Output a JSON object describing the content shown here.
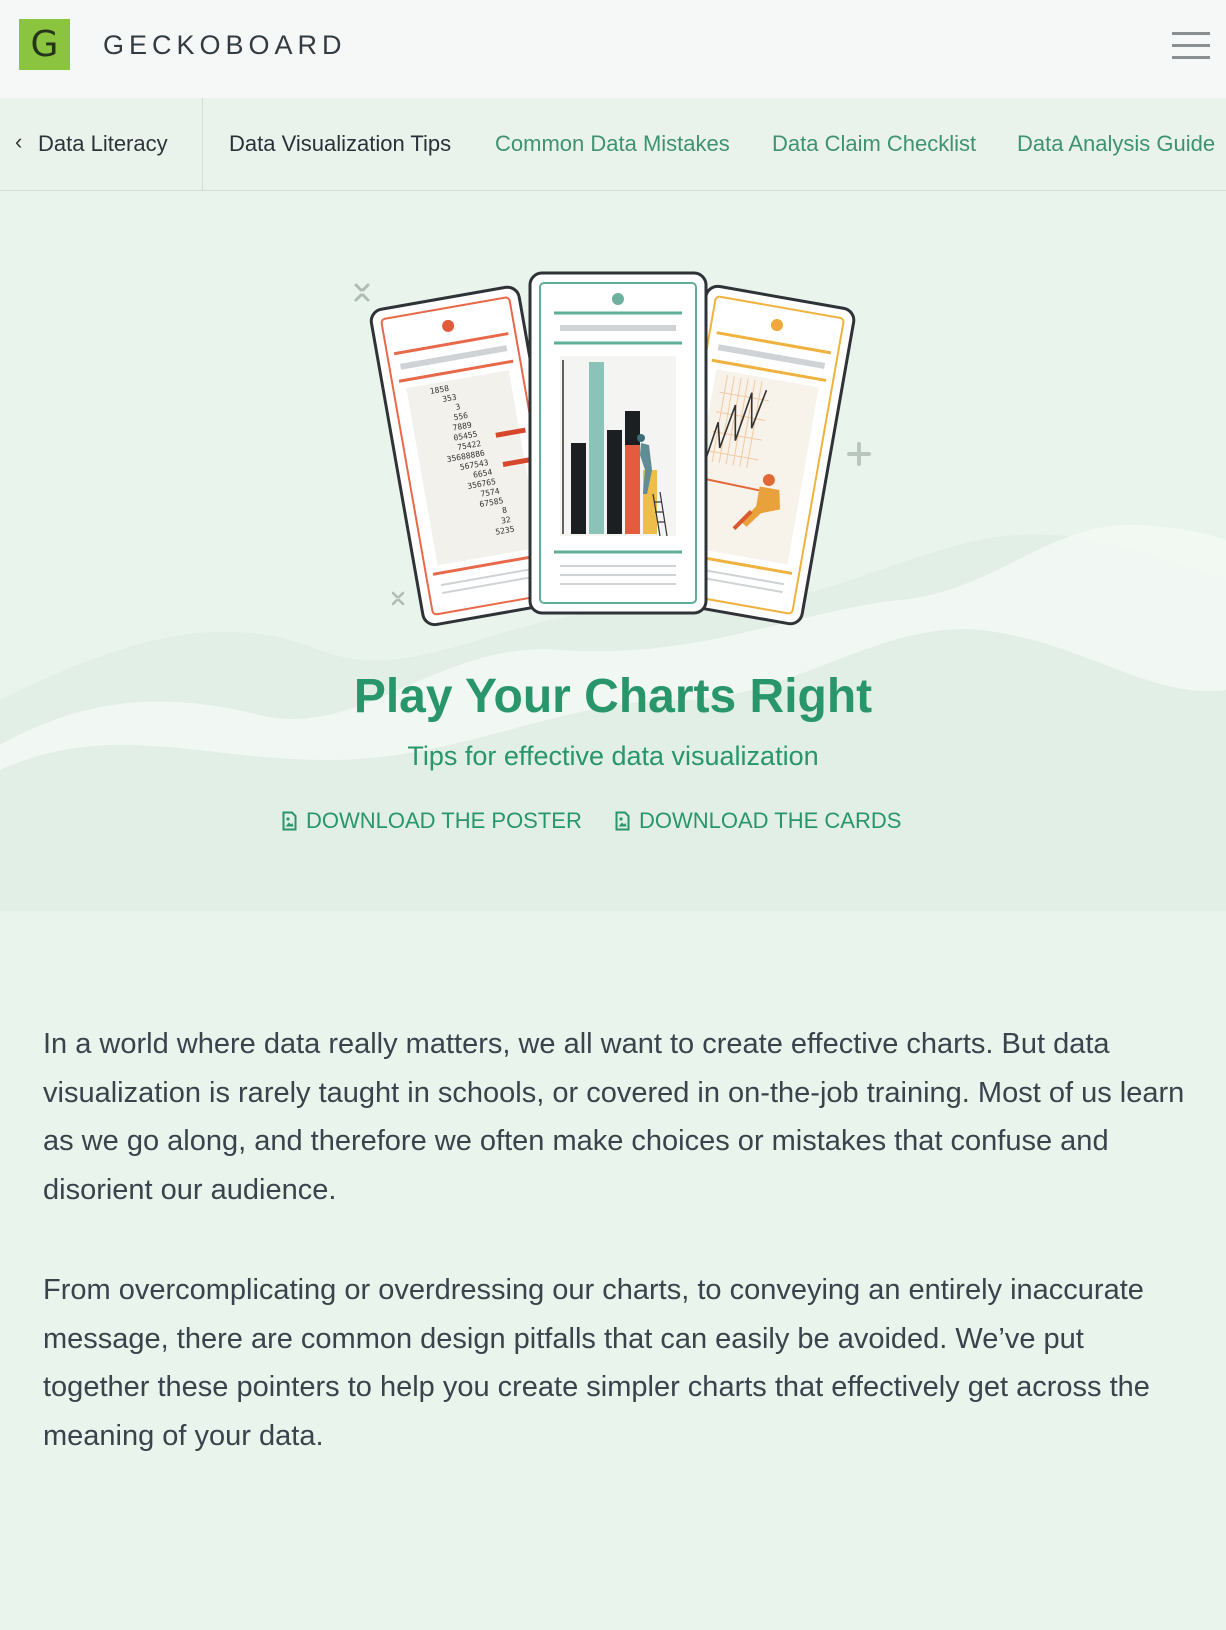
{
  "header": {
    "logo_letter": "G",
    "brand": "GECKOBOARD",
    "menu_icon": "hamburger-menu-icon"
  },
  "subnav": {
    "back_label": "Data Literacy",
    "back_icon": "chevron-left-icon",
    "tabs": [
      {
        "label": "Data Visualization Tips",
        "active": true
      },
      {
        "label": "Common Data Mistakes",
        "active": false
      },
      {
        "label": "Data Claim Checklist",
        "active": false
      },
      {
        "label": "Data Analysis Guide",
        "active": false
      }
    ]
  },
  "hero": {
    "card_numbers": [
      "1858",
      "353",
      "3",
      "556",
      "7889",
      "05455",
      "75422",
      "35688886",
      "567543",
      "6654",
      "356765",
      "7574",
      "67585",
      "8",
      "32",
      "5235"
    ],
    "title": "Play Your Charts Right",
    "subtitle": "Tips for effective data visualization",
    "downloads": {
      "poster_label": "DOWNLOAD THE POSTER",
      "cards_label": "DOWNLOAD THE CARDS",
      "icon": "file-image-icon"
    }
  },
  "body": {
    "paragraph1": "In a world where data really matters, we all want to create effective charts. But data visualization is rarely taught in schools, or covered in on-the-job training. Most of us learn as we go along, and therefore we often make choices or mistakes that confuse and disorient our audience.",
    "paragraph2": "From overcomplicating or overdressing our charts, to conveying an entirely inaccurate message, there are common design pitfalls that can easily be avoided. We’ve put together these pointers to help you create simpler charts that effectively get across the meaning of your data."
  },
  "colors": {
    "brand_green": "#8bc53f",
    "accent_green": "#28966a",
    "nav_link": "#3f9270",
    "page_bg": "#e9f4ec",
    "header_bg": "#f6f8f8"
  }
}
